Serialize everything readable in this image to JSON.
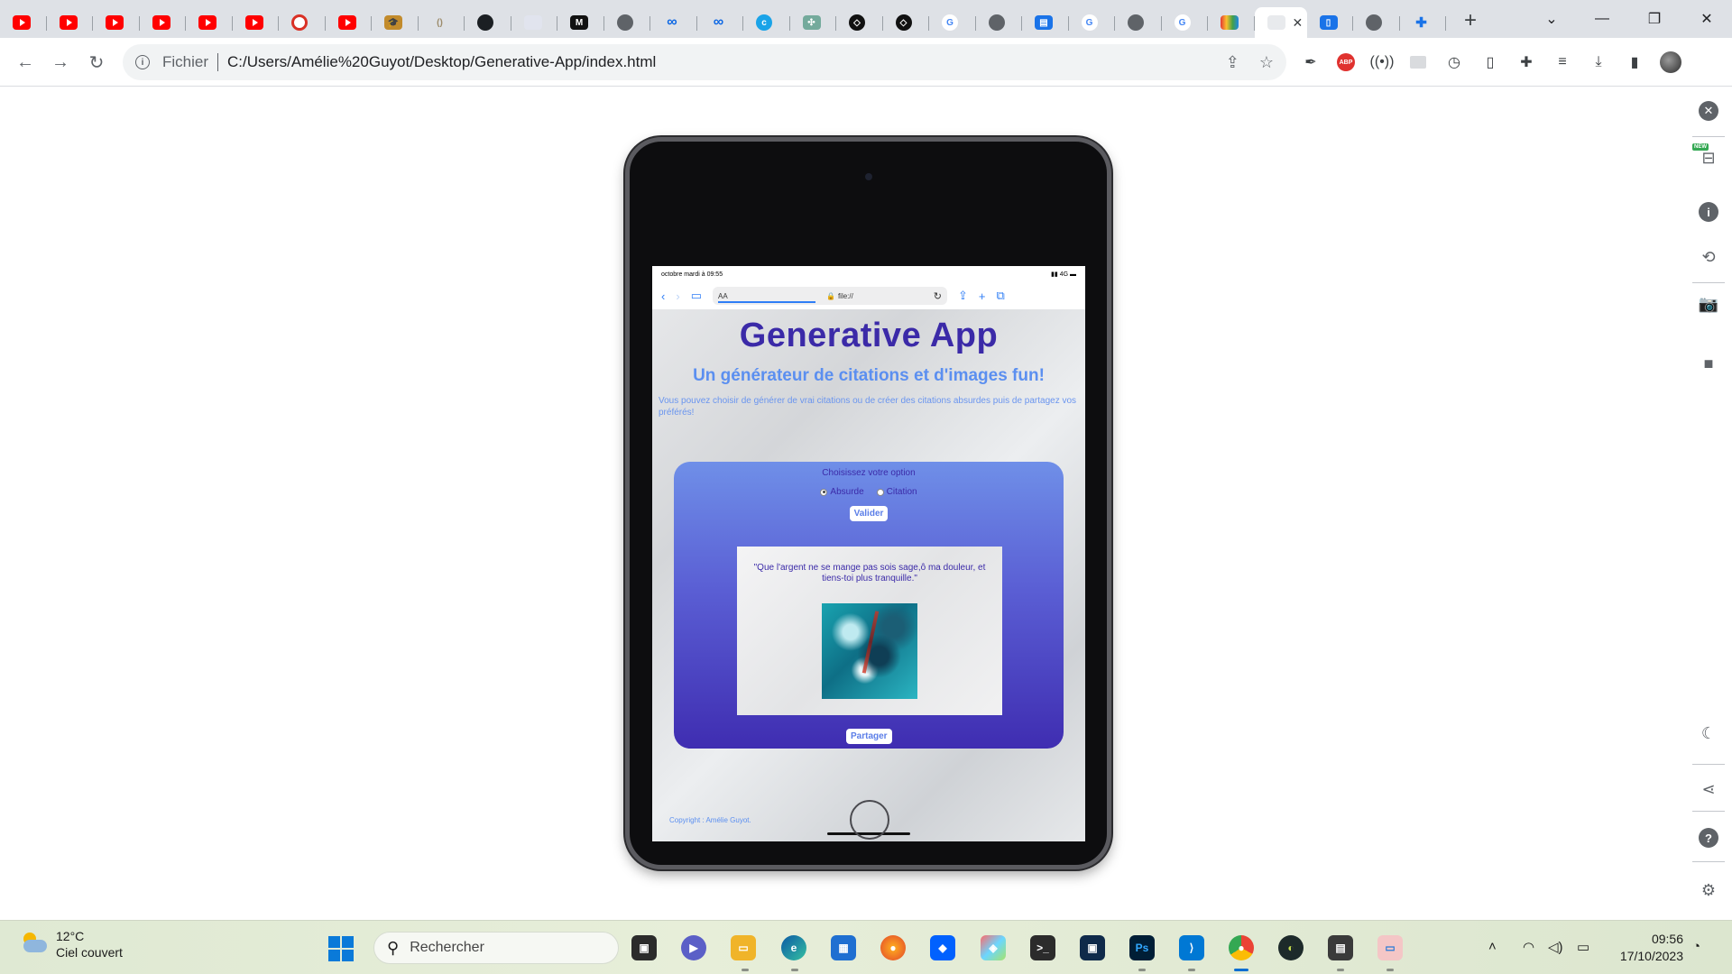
{
  "browser": {
    "tabs": [
      {
        "icon": "youtube-icon"
      },
      {
        "icon": "youtube-icon"
      },
      {
        "icon": "youtube-icon"
      },
      {
        "icon": "youtube-icon"
      },
      {
        "icon": "youtube-icon"
      },
      {
        "icon": "youtube-icon"
      },
      {
        "icon": "record-icon"
      },
      {
        "icon": "youtube-icon"
      },
      {
        "icon": "graduate-icon"
      },
      {
        "icon": "moon-icon"
      },
      {
        "icon": "github-icon"
      },
      {
        "icon": "page-icon"
      },
      {
        "icon": "medium-icon"
      },
      {
        "icon": "globe-icon"
      },
      {
        "icon": "meta-icon"
      },
      {
        "icon": "meta-icon"
      },
      {
        "icon": "c-icon"
      },
      {
        "icon": "openai-icon"
      },
      {
        "icon": "codepen-icon"
      },
      {
        "icon": "codepen-icon"
      },
      {
        "icon": "google-icon"
      },
      {
        "icon": "globe-icon"
      },
      {
        "icon": "forms-icon"
      },
      {
        "icon": "google-icon"
      },
      {
        "icon": "globe-icon"
      },
      {
        "icon": "google-icon"
      },
      {
        "icon": "rainbow-icon"
      },
      {
        "icon": "blank-icon",
        "active": true
      },
      {
        "icon": "device-icon"
      },
      {
        "icon": "globe-icon"
      },
      {
        "icon": "puzzle-icon"
      }
    ],
    "tab_close": "✕",
    "new_tab": "+",
    "window": {
      "minimize": "—",
      "maximize": "❐",
      "close": "✕",
      "tab_search": "⌄"
    },
    "address": {
      "scheme_label": "Fichier",
      "url": "C:/Users/Amélie%20Guyot/Desktop/Generative-App/index.html"
    }
  },
  "ipad": {
    "status": {
      "time": "octobre mardi à 09:55",
      "network": "4G"
    },
    "safari": {
      "aa_label": "AA",
      "url": "file://"
    },
    "app": {
      "title": "Generative App",
      "subtitle": "Un générateur de citations et d'images fun!",
      "description": "Vous pouvez choisir de générer de vrai citations ou de créer des citations absurdes puis de partagez vos préférés!",
      "option_label": "Choisissez votre option",
      "radio_absurde": "Absurde",
      "radio_citation": "Citation",
      "selected": "Absurde",
      "valider": "Valider",
      "quote": "\"Que l'argent ne se mange pas sois sage,ô ma douleur, et tiens-toi plus tranquille.\"",
      "partager": "Partager",
      "copyright": "Copyright : Amélie Guyot."
    },
    "colors": {
      "title": "#3b2aa8",
      "accent": "#5b8ff0",
      "card_top": "#6f8fe8",
      "card_bottom": "#3f2db1"
    }
  },
  "sidebar": {
    "new_badge": "NEW"
  },
  "taskbar": {
    "weather": {
      "temp": "12°C",
      "desc": "Ciel couvert"
    },
    "search_placeholder": "Rechercher",
    "clock": {
      "time": "09:56",
      "date": "17/10/2023"
    }
  }
}
